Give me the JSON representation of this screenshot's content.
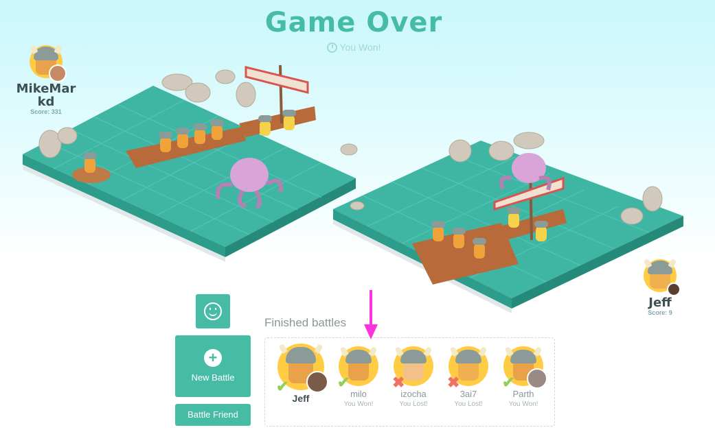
{
  "header": {
    "title": "Game Over",
    "subtitle": "You Won!"
  },
  "players": {
    "left": {
      "name_line1": "MikeMar",
      "name_line2": "kd",
      "score": "Score: 331"
    },
    "right": {
      "name": "Jeff",
      "score": "Score: 9"
    }
  },
  "actions": {
    "new_battle": "New Battle",
    "battle_friend": "Battle Friend",
    "plus": "+"
  },
  "finished": {
    "title": "Finished battles",
    "items": [
      {
        "name": "Jeff",
        "result": "",
        "outcome": "win"
      },
      {
        "name": "milo",
        "result": "You Won!",
        "outcome": "win"
      },
      {
        "name": "izocha",
        "result": "You Lost!",
        "outcome": "lose"
      },
      {
        "name": "3ai7",
        "result": "You Lost!",
        "outcome": "lose"
      },
      {
        "name": "Parth",
        "result": "You Won!",
        "outcome": "win"
      }
    ]
  },
  "icons": {
    "win": "check-icon",
    "lose": "cross-icon",
    "emote": "smiley-icon"
  },
  "colors": {
    "accent": "#46bca5",
    "ring": "#ffcc44",
    "tile": "#3fb5a3",
    "arrow": "#ff33dd"
  }
}
